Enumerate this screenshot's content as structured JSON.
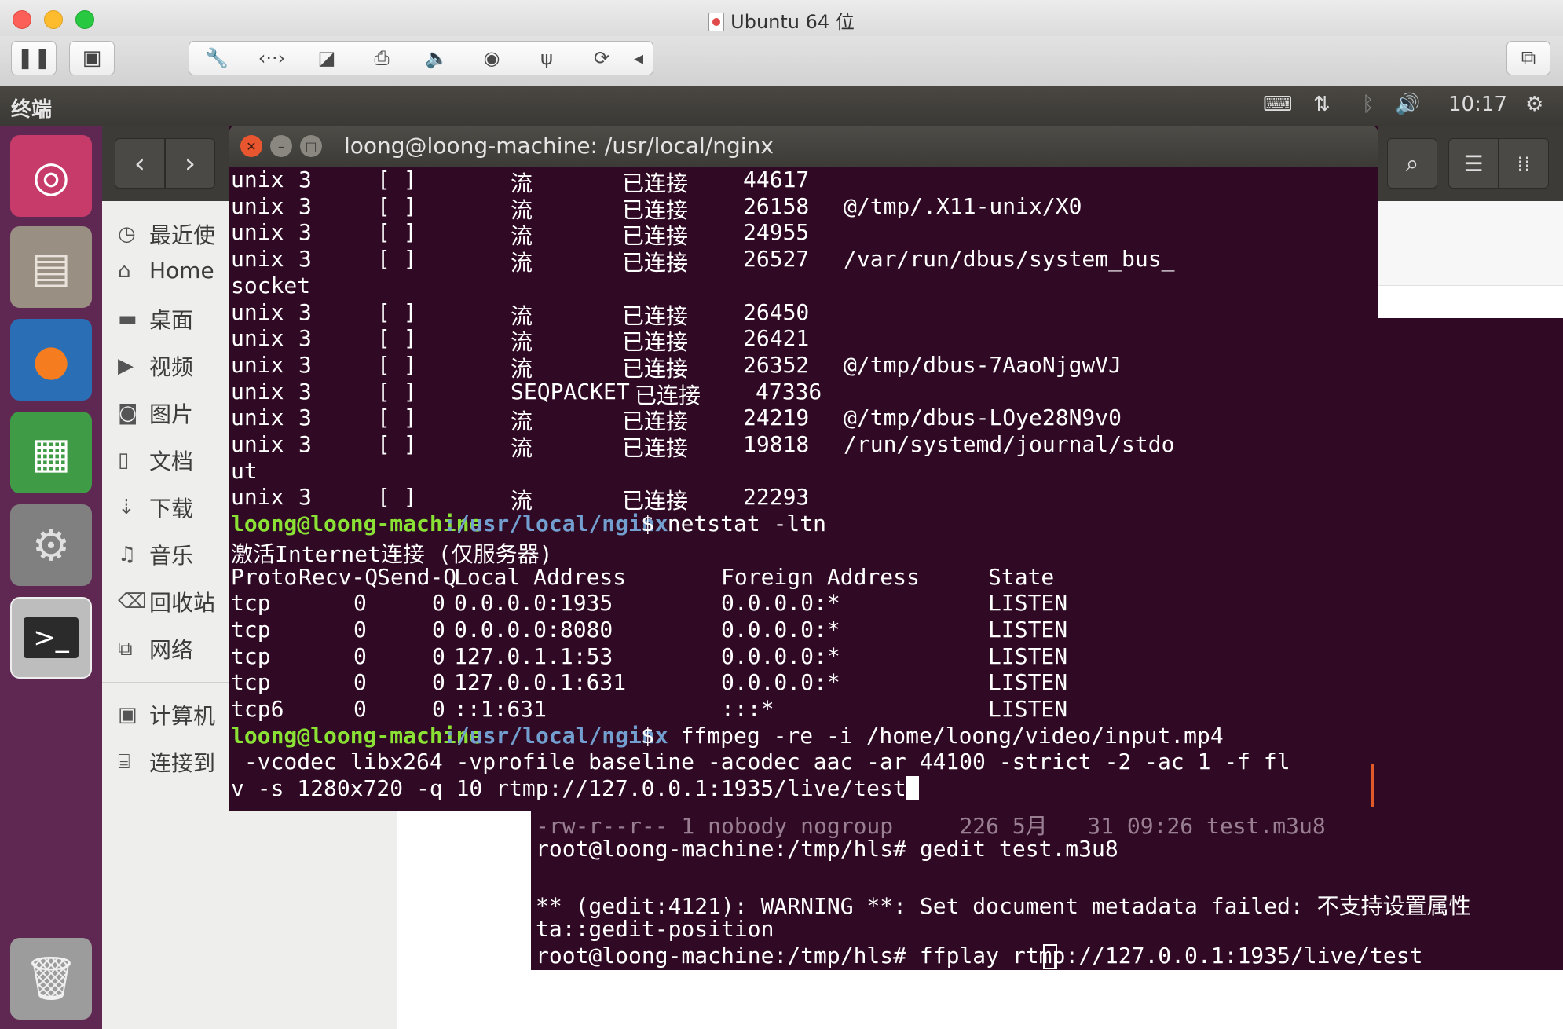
{
  "vm": {
    "title": "Ubuntu 64 位",
    "toolbar_icons": [
      "pause-icon",
      "snapshot-icon",
      "wrench-icon",
      "network-arrows-icon",
      "disk-icon",
      "printer-icon",
      "speaker-icon",
      "camera-icon",
      "usb-icon",
      "sync-icon",
      "collapse-arrow-icon",
      "restore-window-icon"
    ]
  },
  "panel": {
    "app_name": "终端",
    "time": "10:17"
  },
  "launcher": {
    "items": [
      "ubuntu-dash-icon",
      "files-icon",
      "firefox-icon",
      "libreoffice-calc-icon",
      "system-settings-icon",
      "terminal-icon",
      "trash-icon"
    ]
  },
  "files": {
    "sidebar": [
      "最近使",
      "Home",
      "桌面",
      "视频",
      "图片",
      "文档",
      "下载",
      "音乐",
      "回收站",
      "网络",
      "计算机",
      "连接到"
    ]
  },
  "terminal": {
    "title": "loong@loong-machine: /usr/local/nginx",
    "socket_rows": [
      {
        "proto": "unix",
        "refcnt": "3",
        "flags": "[ ]",
        "type": "流",
        "state": "已连接",
        "inode": "44617",
        "path": ""
      },
      {
        "proto": "unix",
        "refcnt": "3",
        "flags": "[ ]",
        "type": "流",
        "state": "已连接",
        "inode": "26158",
        "path": "@/tmp/.X11-unix/X0"
      },
      {
        "proto": "unix",
        "refcnt": "3",
        "flags": "[ ]",
        "type": "流",
        "state": "已连接",
        "inode": "24955",
        "path": ""
      },
      {
        "proto": "unix",
        "refcnt": "3",
        "flags": "[ ]",
        "type": "流",
        "state": "已连接",
        "inode": "26527",
        "path": "/var/run/dbus/system_bus_"
      },
      {
        "wrap": "socket"
      },
      {
        "proto": "unix",
        "refcnt": "3",
        "flags": "[ ]",
        "type": "流",
        "state": "已连接",
        "inode": "26450",
        "path": ""
      },
      {
        "proto": "unix",
        "refcnt": "3",
        "flags": "[ ]",
        "type": "流",
        "state": "已连接",
        "inode": "26421",
        "path": ""
      },
      {
        "proto": "unix",
        "refcnt": "3",
        "flags": "[ ]",
        "type": "流",
        "state": "已连接",
        "inode": "26352",
        "path": "@/tmp/dbus-7AaoNjgwVJ"
      },
      {
        "proto": "unix",
        "refcnt": "3",
        "flags": "[ ]",
        "type": "SEQPACKET",
        "state": "已连接",
        "inode": "47336",
        "path": "",
        "seq": true
      },
      {
        "proto": "unix",
        "refcnt": "3",
        "flags": "[ ]",
        "type": "流",
        "state": "已连接",
        "inode": "24219",
        "path": "@/tmp/dbus-LOye28N9v0"
      },
      {
        "proto": "unix",
        "refcnt": "3",
        "flags": "[ ]",
        "type": "流",
        "state": "已连接",
        "inode": "19818",
        "path": "/run/systemd/journal/stdo"
      },
      {
        "wrap": "ut"
      },
      {
        "proto": "unix",
        "refcnt": "3",
        "flags": "[ ]",
        "type": "流",
        "state": "已连接",
        "inode": "22293",
        "path": ""
      }
    ],
    "prompt_user": "loong@loong-machine",
    "prompt_path": ":/usr/local/nginx",
    "cmd1": "$ netstat -ltn",
    "netstat_heading": "激活Internet连接 (仅服务器)",
    "tcp_header": [
      "Proto",
      "Recv-Q",
      "Send-Q",
      "Local Address",
      "Foreign Address",
      "State"
    ],
    "tcp_rows": [
      [
        "tcp",
        "0",
        "0",
        "0.0.0.0:1935",
        "0.0.0.0:*",
        "LISTEN"
      ],
      [
        "tcp",
        "0",
        "0",
        "0.0.0.0:8080",
        "0.0.0.0:*",
        "LISTEN"
      ],
      [
        "tcp",
        "0",
        "0",
        "127.0.1.1:53",
        "0.0.0.0:*",
        "LISTEN"
      ],
      [
        "tcp",
        "0",
        "0",
        "127.0.0.1:631",
        "0.0.0.0:*",
        "LISTEN"
      ],
      [
        "tcp6",
        "0",
        "0",
        "::1:631",
        ":::*",
        "LISTEN"
      ]
    ],
    "cmd2_line1": "$  ffmpeg -re -i /home/loong/video/input.mp4",
    "cmd2_line2": " -vcodec libx264 -vprofile baseline -acodec aac -ar 44100 -strict -2 -ac 1 -f fl",
    "cmd2_line3": "v -s 1280x720 -q 10 rtmp://127.0.0.1:1935/live/test"
  },
  "terminal2": {
    "lines": [
      "-rw-r--r-- 1 nobody nogroup     226 5月   31 09:26 test.m3u8",
      "root@loong-machine:/tmp/hls# gedit test.m3u8",
      "",
      "** (gedit:4121): WARNING **: Set document metadata failed: 不支持设置属性",
      "ta::gedit-position",
      "root@loong-machine:/tmp/hls# ffplay rtmp://127.0.0.1:1935/live/test"
    ]
  }
}
